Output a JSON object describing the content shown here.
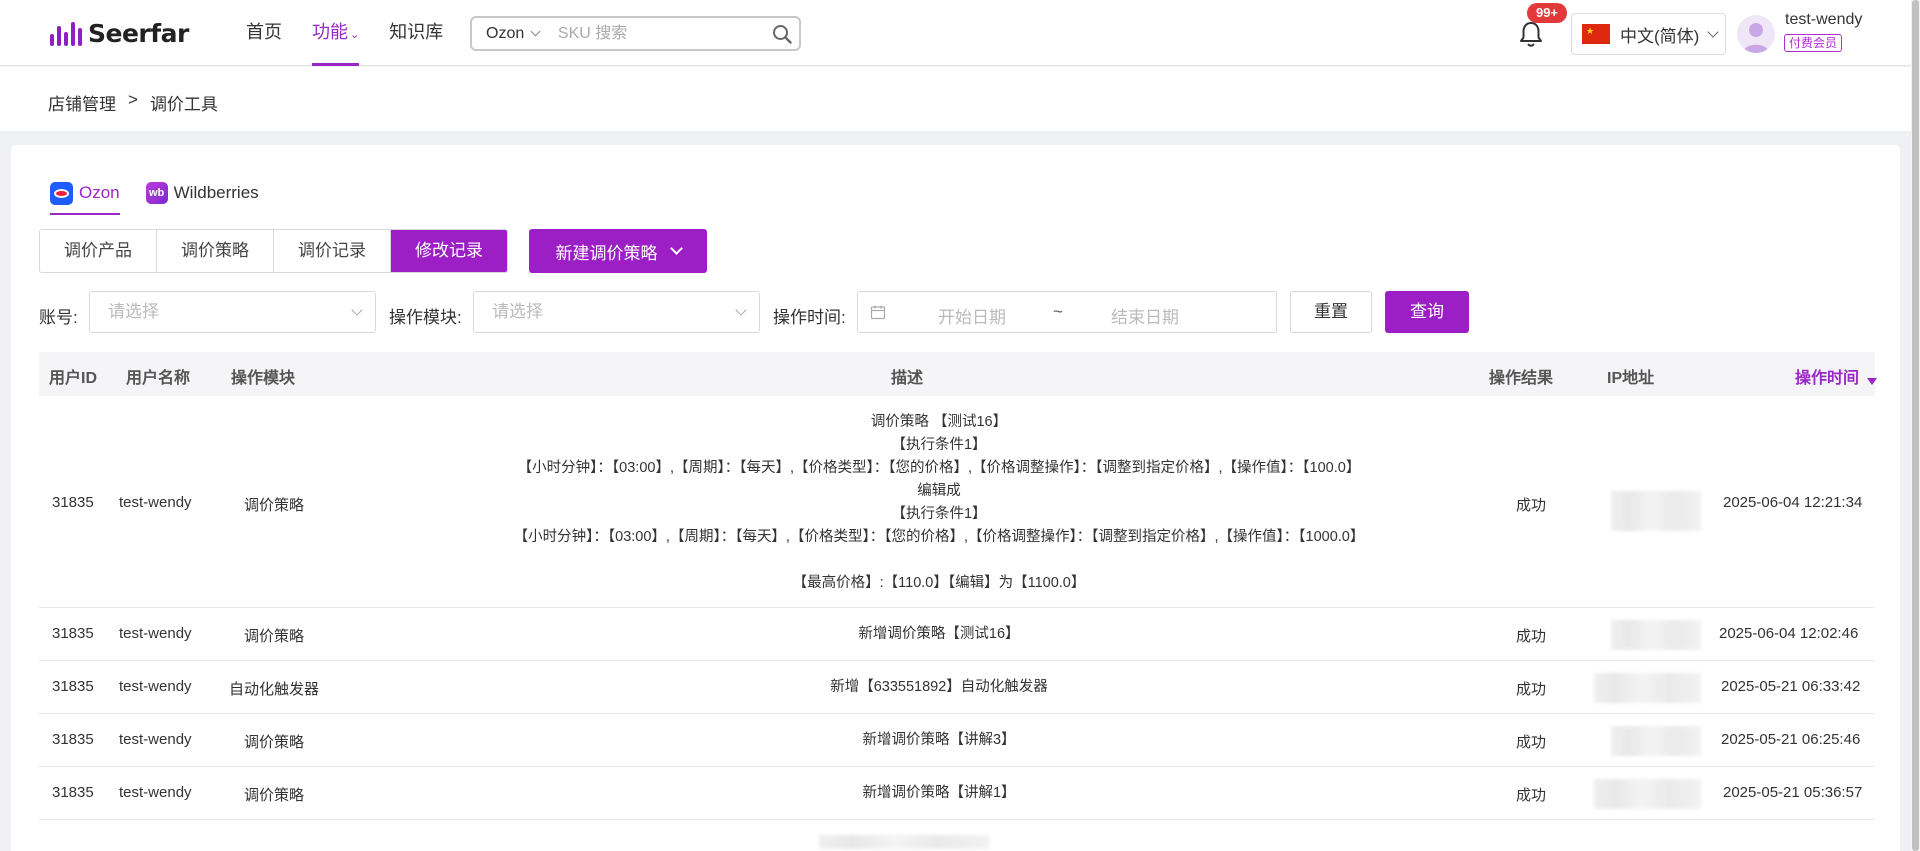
{
  "header": {
    "logo_text": "Seerfar",
    "nav": [
      {
        "label": "首页",
        "active": false
      },
      {
        "label": "功能",
        "active": true
      },
      {
        "label": "知识库",
        "active": false
      }
    ],
    "search": {
      "platform": "Ozon",
      "placeholder": "SKU 搜索"
    },
    "notification_badge": "99+",
    "language": "中文(简体)",
    "user": {
      "name": "test-wendy",
      "membership": "付费会员"
    }
  },
  "breadcrumb": {
    "parent": "店铺管理",
    "separator": ">",
    "current": "调价工具"
  },
  "platform_tabs": [
    {
      "label": "Ozon",
      "icon": "ozon-icon",
      "active": true
    },
    {
      "label": "Wildberries",
      "icon": "wildberries-icon",
      "active": false
    }
  ],
  "segments": [
    {
      "label": "调价产品",
      "active": false
    },
    {
      "label": "调价策略",
      "active": false
    },
    {
      "label": "调价记录",
      "active": false
    },
    {
      "label": "修改记录",
      "active": true
    }
  ],
  "new_strategy_button": "新建调价策略",
  "filters": {
    "account_label": "账号:",
    "account_placeholder": "请选择",
    "module_label": "操作模块:",
    "module_placeholder": "请选择",
    "time_label": "操作时间:",
    "start_placeholder": "开始日期",
    "range_separator": "~",
    "end_placeholder": "结束日期",
    "reset": "重置",
    "query": "查询"
  },
  "table": {
    "columns": [
      "用户ID",
      "用户名称",
      "操作模块",
      "描述",
      "操作结果",
      "IP地址",
      "操作时间"
    ],
    "sorted_column": "操作时间",
    "rows": [
      {
        "user_id": "31835",
        "user_name": "test-wendy",
        "module": "调价策略",
        "description": [
          "调价策略 【测试16】",
          "【执行条件1】",
          "【小时分钟】：【03:00】,【周期】：【每天】,【价格类型】：【您的价格】,【价格调整操作】：【调整到指定价格】,【操作值】：【100.0】",
          "编辑成",
          "【执行条件1】",
          "【小时分钟】：【03:00】,【周期】：【每天】,【价格类型】：【您的价格】,【价格调整操作】：【调整到指定价格】,【操作值】：【1000.0】",
          "",
          "【最高价格】:【110.0】【编辑】为【1100.0】"
        ],
        "result": "成功",
        "time": "2025-06-04 12:21:34"
      },
      {
        "user_id": "31835",
        "user_name": "test-wendy",
        "module": "调价策略",
        "description": [
          "新增调价策略【测试16】"
        ],
        "result": "成功",
        "time": "2025-06-04 12:02:46"
      },
      {
        "user_id": "31835",
        "user_name": "test-wendy",
        "module": "自动化触发器",
        "description": [
          "新增【633551892】自动化触发器"
        ],
        "result": "成功",
        "time": "2025-05-21 06:33:42"
      },
      {
        "user_id": "31835",
        "user_name": "test-wendy",
        "module": "调价策略",
        "description": [
          "新增调价策略【讲解3】"
        ],
        "result": "成功",
        "time": "2025-05-21 06:25:46"
      },
      {
        "user_id": "31835",
        "user_name": "test-wendy",
        "module": "调价策略",
        "description": [
          "新增调价策略【讲解1】"
        ],
        "result": "成功",
        "time": "2025-05-21 05:36:57"
      }
    ]
  },
  "colors": {
    "brand": "#9b1fc5",
    "badge": "#e23a3a"
  }
}
